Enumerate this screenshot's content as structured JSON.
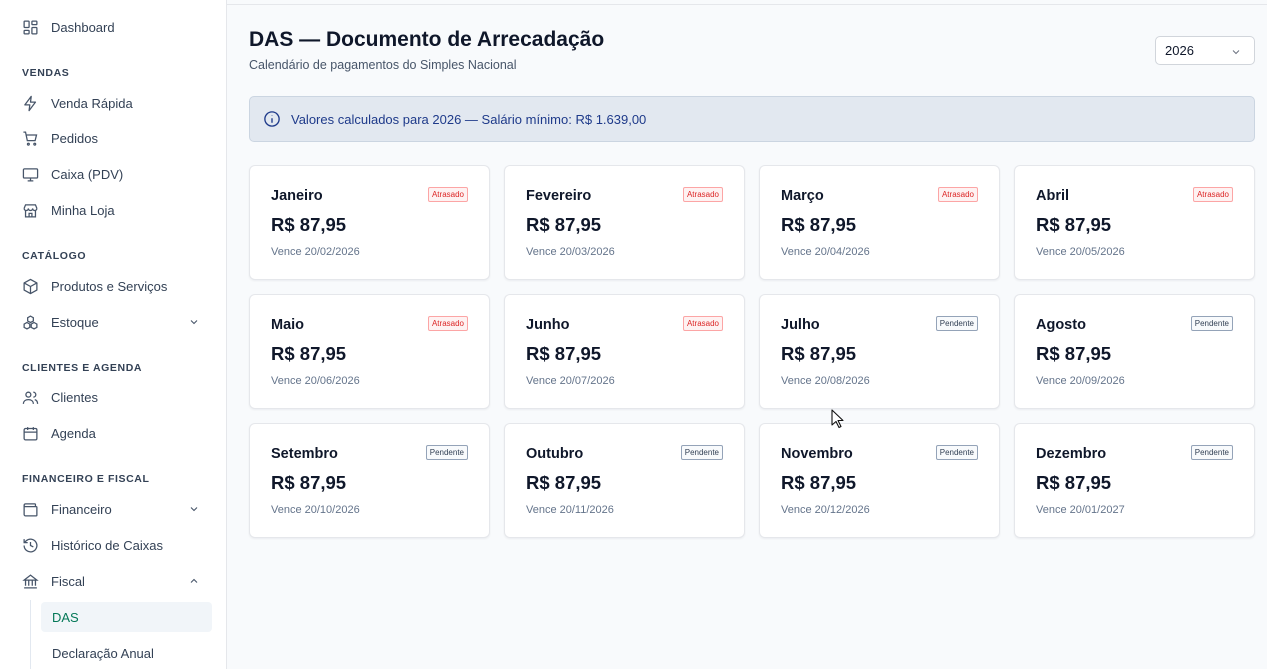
{
  "sidebar": {
    "dashboard": "Dashboard",
    "sections": {
      "vendas": "VENDAS",
      "catalogo": "CATÁLOGO",
      "clientes_agenda": "CLIENTES E AGENDA",
      "financeiro_fiscal": "FINANCEIRO E FISCAL"
    },
    "items": {
      "venda_rapida": "Venda Rápida",
      "pedidos": "Pedidos",
      "caixa_pdv": "Caixa (PDV)",
      "minha_loja": "Minha Loja",
      "produtos_servicos": "Produtos e Serviços",
      "estoque": "Estoque",
      "clientes": "Clientes",
      "agenda": "Agenda",
      "financeiro": "Financeiro",
      "historico_caixas": "Histórico de Caixas",
      "fiscal": "Fiscal"
    },
    "fiscal_sub": {
      "das": "DAS",
      "declaracao_anual": "Declaração Anual"
    }
  },
  "header": {
    "title": "DAS — Documento de Arrecadação",
    "subtitle": "Calendário de pagamentos do Simples Nacional",
    "year": "2026"
  },
  "info_banner": "Valores calculados para 2026 — Salário mínimo: R$ 1.639,00",
  "months": [
    {
      "name": "Janeiro",
      "amount": "R$ 87,95",
      "due": "Vence 20/02/2026",
      "status": "Atrasado",
      "kind": "late"
    },
    {
      "name": "Fevereiro",
      "amount": "R$ 87,95",
      "due": "Vence 20/03/2026",
      "status": "Atrasado",
      "kind": "late"
    },
    {
      "name": "Março",
      "amount": "R$ 87,95",
      "due": "Vence 20/04/2026",
      "status": "Atrasado",
      "kind": "late"
    },
    {
      "name": "Abril",
      "amount": "R$ 87,95",
      "due": "Vence 20/05/2026",
      "status": "Atrasado",
      "kind": "late"
    },
    {
      "name": "Maio",
      "amount": "R$ 87,95",
      "due": "Vence 20/06/2026",
      "status": "Atrasado",
      "kind": "late"
    },
    {
      "name": "Junho",
      "amount": "R$ 87,95",
      "due": "Vence 20/07/2026",
      "status": "Atrasado",
      "kind": "late"
    },
    {
      "name": "Julho",
      "amount": "R$ 87,95",
      "due": "Vence 20/08/2026",
      "status": "Pendente",
      "kind": "pending"
    },
    {
      "name": "Agosto",
      "amount": "R$ 87,95",
      "due": "Vence 20/09/2026",
      "status": "Pendente",
      "kind": "pending"
    },
    {
      "name": "Setembro",
      "amount": "R$ 87,95",
      "due": "Vence 20/10/2026",
      "status": "Pendente",
      "kind": "pending"
    },
    {
      "name": "Outubro",
      "amount": "R$ 87,95",
      "due": "Vence 20/11/2026",
      "status": "Pendente",
      "kind": "pending"
    },
    {
      "name": "Novembro",
      "amount": "R$ 87,95",
      "due": "Vence 20/12/2026",
      "status": "Pendente",
      "kind": "pending"
    },
    {
      "name": "Dezembro",
      "amount": "R$ 87,95",
      "due": "Vence 20/01/2027",
      "status": "Pendente",
      "kind": "pending"
    }
  ],
  "colors": {
    "accent": "#047857",
    "late": "#dc2626",
    "info_text": "#1e3a8a"
  }
}
